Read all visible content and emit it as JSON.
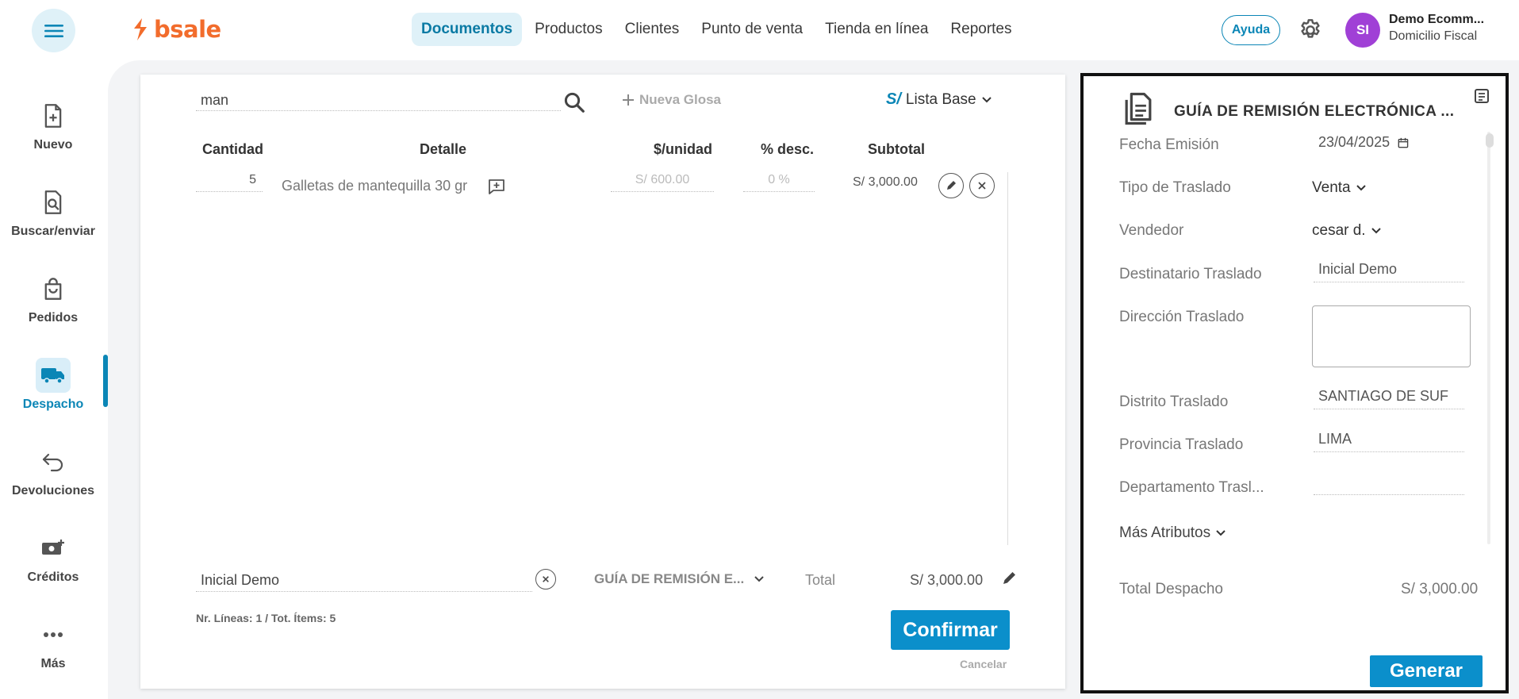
{
  "app": {
    "logo_text": "bsale",
    "brand_color": "#f26c2c",
    "accent_color": "#0b8fcb"
  },
  "nav": {
    "items": [
      {
        "label": "Documentos",
        "active": true
      },
      {
        "label": "Productos"
      },
      {
        "label": "Clientes"
      },
      {
        "label": "Punto de venta"
      },
      {
        "label": "Tienda en línea"
      },
      {
        "label": "Reportes"
      }
    ],
    "help": "Ayuda"
  },
  "account": {
    "initials": "SI",
    "name": "Demo Ecomm...",
    "subtitle": "Domicilio Fiscal"
  },
  "sidebar": {
    "items": [
      {
        "label": "Nuevo",
        "icon": "file-plus-icon"
      },
      {
        "label": "Buscar/enviar",
        "icon": "file-search-icon"
      },
      {
        "label": "Pedidos",
        "icon": "bag-icon"
      },
      {
        "label": "Despacho",
        "icon": "truck-icon",
        "active": true
      },
      {
        "label": "Devoluciones",
        "icon": "return-icon"
      },
      {
        "label": "Créditos",
        "icon": "money-plus-icon"
      },
      {
        "label": "Más",
        "icon": "more-icon"
      }
    ]
  },
  "document": {
    "search_value": "man",
    "nueva_glosa": "Nueva Glosa",
    "price_list_symbol": "S/",
    "price_list": "Lista Base",
    "columns": {
      "cantidad": "Cantidad",
      "detalle": "Detalle",
      "unidad": "$/unidad",
      "desc": "% desc.",
      "subtotal": "Subtotal"
    },
    "rows": [
      {
        "cantidad": "5",
        "detalle": "Galletas de mantequilla 30 gr",
        "unidad": "S/ 600.00",
        "desc": "0 %",
        "subtotal": "S/ 3,000.00"
      }
    ],
    "client": "Inicial Demo",
    "doc_type": "GUÍA DE REMISIÓN E...",
    "total_label": "Total",
    "total_value": "S/ 3,000.00",
    "lines_info": "Nr. Líneas: 1 / Tot. Ítems: 5",
    "confirm": "Confirmar",
    "cancel": "Cancelar"
  },
  "panel": {
    "title": "GUÍA DE REMISIÓN ELECTRÓNICA ...",
    "fields": {
      "fecha_label": "Fecha Emisión",
      "fecha_value": "23/04/2025",
      "tipo_label": "Tipo de Traslado",
      "tipo_value": "Venta",
      "vendedor_label": "Vendedor",
      "vendedor_value": "cesar d.",
      "destinatario_label": "Destinatario Traslado",
      "destinatario_value": "Inicial Demo",
      "direccion_label": "Dirección Traslado",
      "direccion_value": "",
      "distrito_label": "Distrito Traslado",
      "distrito_value": "SANTIAGO DE SUF",
      "provincia_label": "Provincia Traslado",
      "provincia_value": "LIMA",
      "departamento_label": "Departamento Trasl...",
      "departamento_value": ""
    },
    "mas_atributos": "Más Atributos",
    "total_despacho_label": "Total Despacho",
    "total_despacho_value": "S/ 3,000.00",
    "generar": "Generar"
  }
}
